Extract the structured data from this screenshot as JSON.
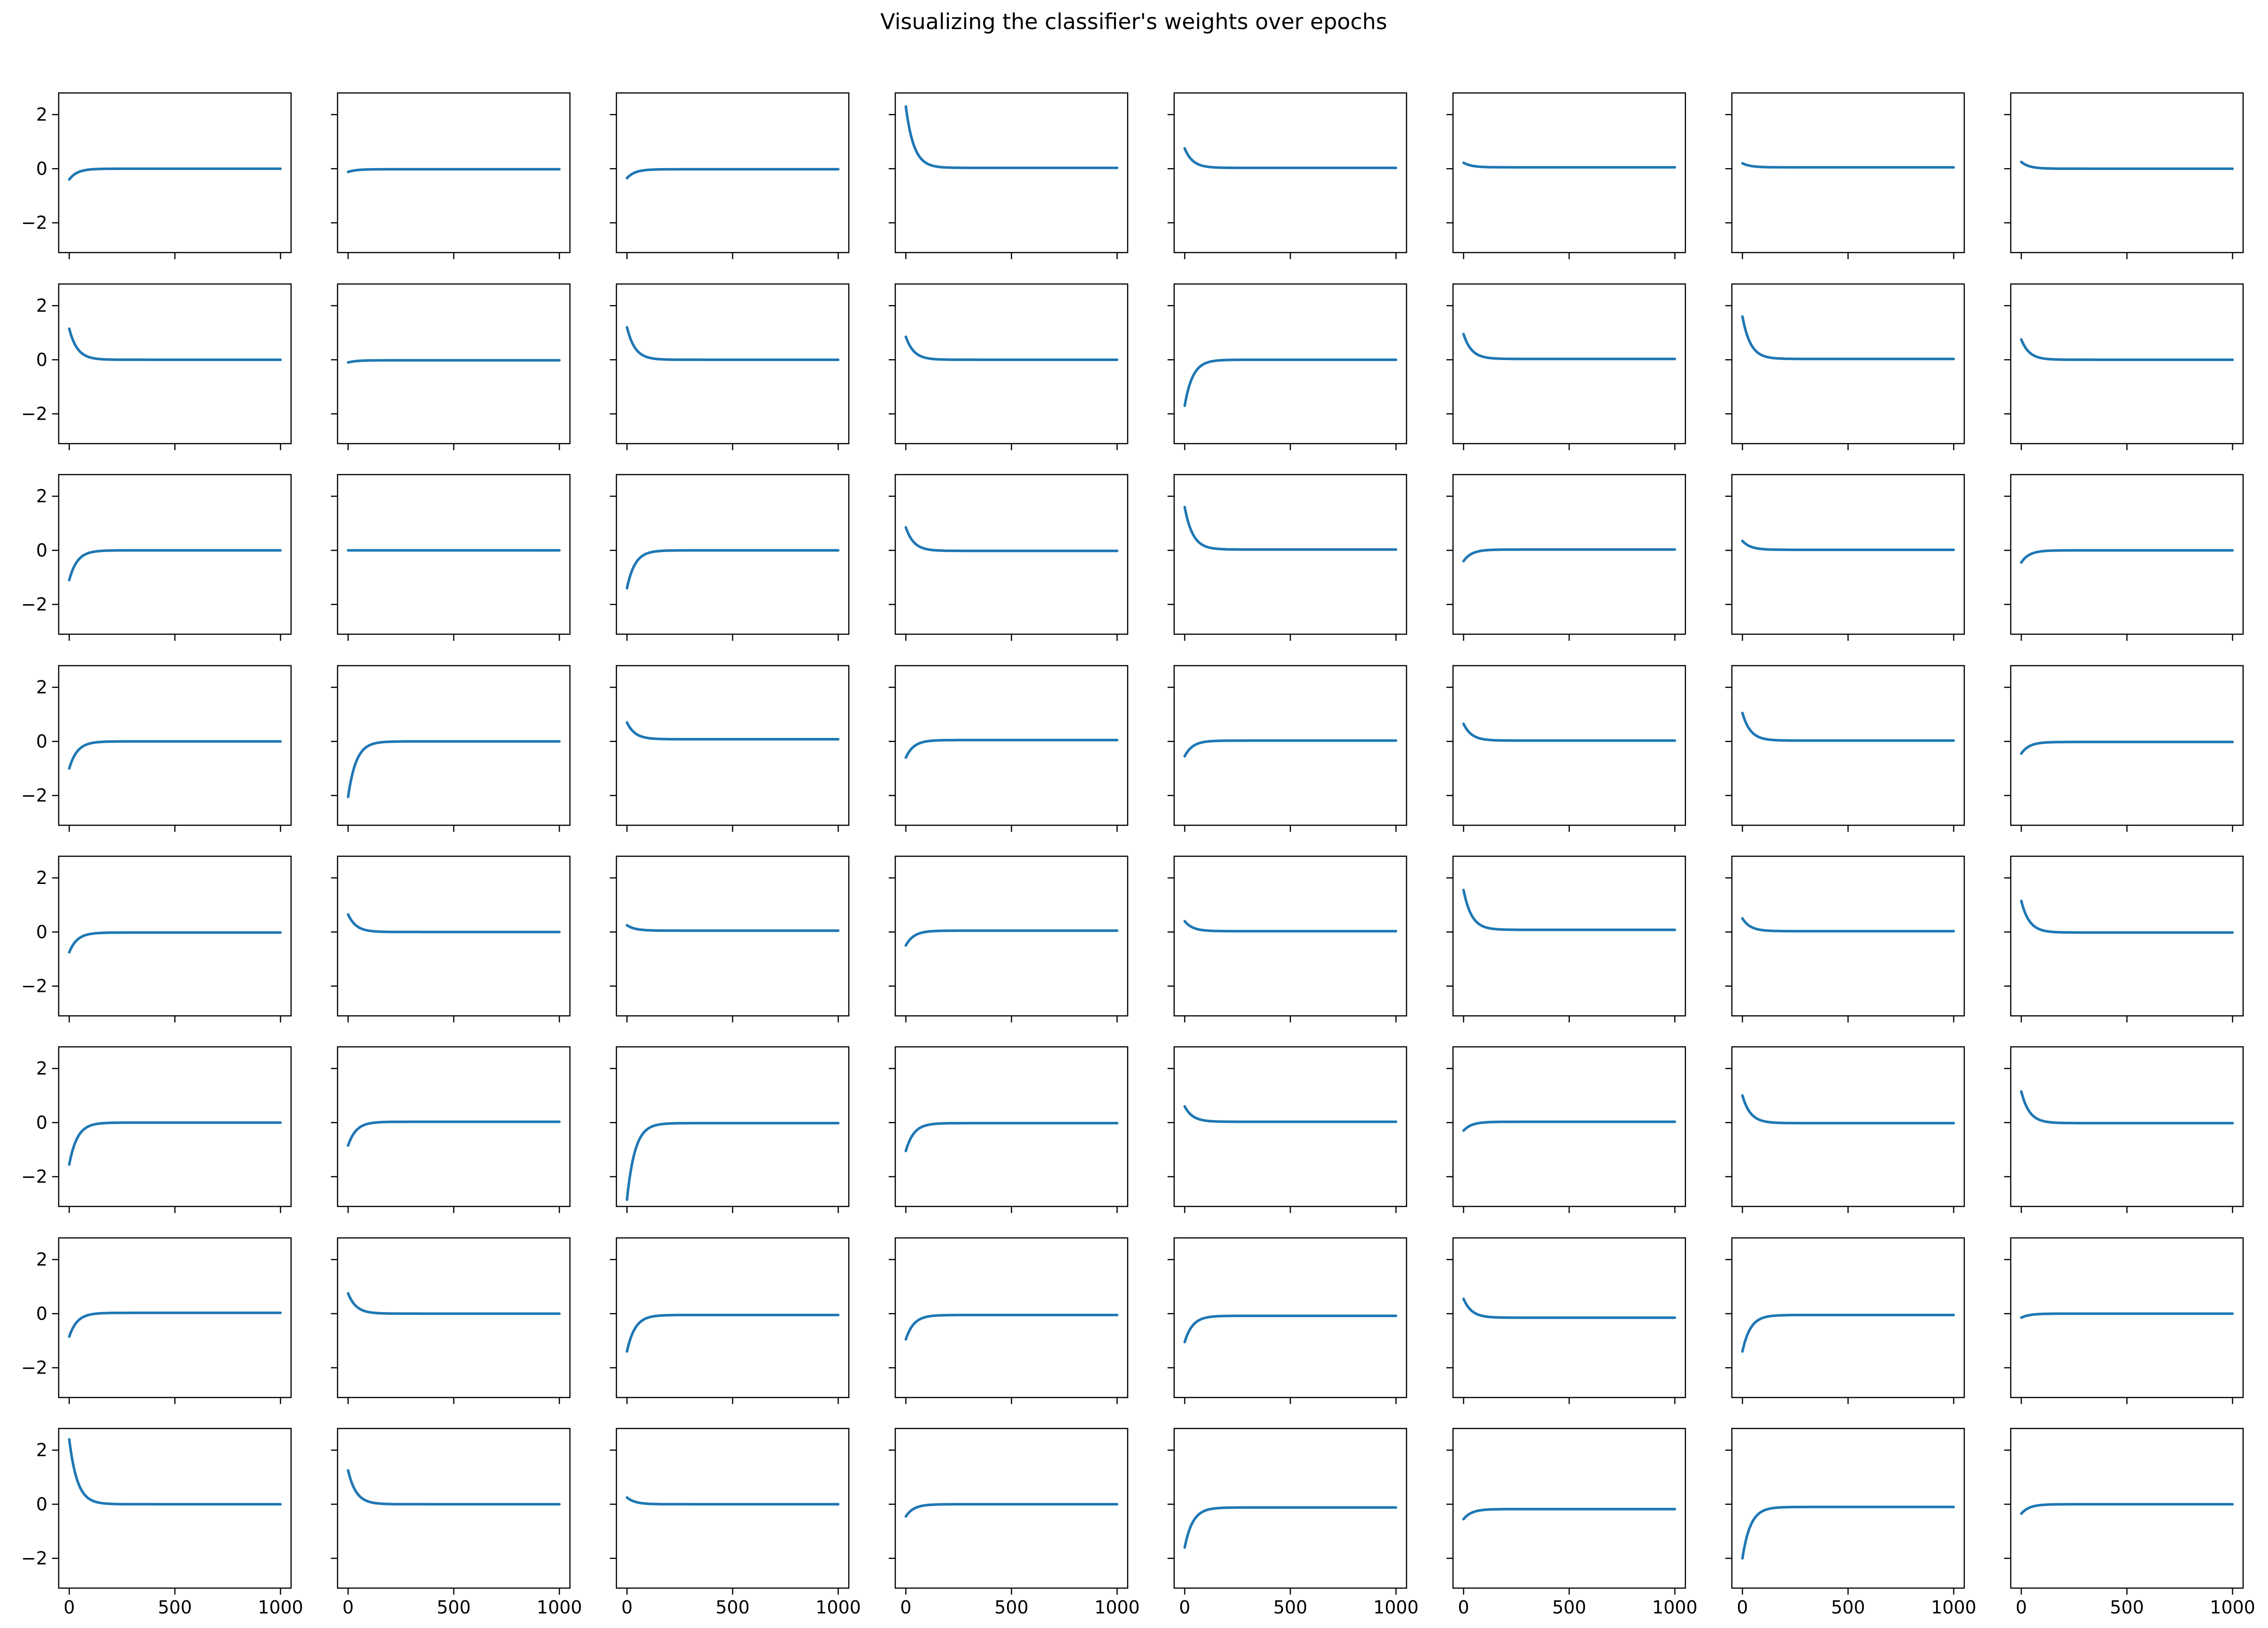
{
  "figure": {
    "title": "Visualizing the classifier's weights over epochs"
  },
  "chart_data": {
    "type": "line",
    "title": "Visualizing the classifier's weights over epochs",
    "xlabel": "",
    "ylabel": "",
    "grid": false,
    "layout_rows": 8,
    "layout_cols": 8,
    "sharex": true,
    "sharey": true,
    "xlim": [
      -50,
      1050
    ],
    "ylim": [
      -3.1,
      2.8
    ],
    "x_ticks": [
      0,
      500,
      1000
    ],
    "y_ticks": [
      2,
      0,
      -2
    ],
    "x_tick_labels": [
      "0",
      "500",
      "1000"
    ],
    "y_tick_labels": [
      "2",
      "0",
      "−2"
    ],
    "line_color": "#1f77b4",
    "epochs": 1000,
    "subplot_note": "Each subplot shows one weight (row-major order, 64 total); each curve starts at start_value and converges toward final_value.",
    "subplots": [
      {
        "row": 0,
        "col": 0,
        "start_value": -0.4,
        "final_value": 0.0
      },
      {
        "row": 0,
        "col": 1,
        "start_value": -0.12,
        "final_value": -0.02
      },
      {
        "row": 0,
        "col": 2,
        "start_value": -0.35,
        "final_value": -0.02
      },
      {
        "row": 0,
        "col": 3,
        "start_value": 2.3,
        "final_value": 0.03
      },
      {
        "row": 0,
        "col": 4,
        "start_value": 0.75,
        "final_value": 0.03
      },
      {
        "row": 0,
        "col": 5,
        "start_value": 0.22,
        "final_value": 0.05
      },
      {
        "row": 0,
        "col": 6,
        "start_value": 0.2,
        "final_value": 0.05
      },
      {
        "row": 0,
        "col": 7,
        "start_value": 0.25,
        "final_value": 0.0
      },
      {
        "row": 1,
        "col": 0,
        "start_value": 1.15,
        "final_value": 0.0
      },
      {
        "row": 1,
        "col": 1,
        "start_value": -0.1,
        "final_value": -0.02
      },
      {
        "row": 1,
        "col": 2,
        "start_value": 1.2,
        "final_value": 0.0
      },
      {
        "row": 1,
        "col": 3,
        "start_value": 0.85,
        "final_value": 0.0
      },
      {
        "row": 1,
        "col": 4,
        "start_value": -1.7,
        "final_value": 0.0
      },
      {
        "row": 1,
        "col": 5,
        "start_value": 0.95,
        "final_value": 0.03
      },
      {
        "row": 1,
        "col": 6,
        "start_value": 1.6,
        "final_value": 0.03
      },
      {
        "row": 1,
        "col": 7,
        "start_value": 0.75,
        "final_value": 0.0
      },
      {
        "row": 2,
        "col": 0,
        "start_value": -1.1,
        "final_value": 0.0
      },
      {
        "row": 2,
        "col": 1,
        "start_value": 0.0,
        "final_value": 0.0
      },
      {
        "row": 2,
        "col": 2,
        "start_value": -1.4,
        "final_value": 0.0
      },
      {
        "row": 2,
        "col": 3,
        "start_value": 0.85,
        "final_value": -0.02
      },
      {
        "row": 2,
        "col": 4,
        "start_value": 1.6,
        "final_value": 0.03
      },
      {
        "row": 2,
        "col": 5,
        "start_value": -0.4,
        "final_value": 0.03
      },
      {
        "row": 2,
        "col": 6,
        "start_value": 0.35,
        "final_value": 0.02
      },
      {
        "row": 2,
        "col": 7,
        "start_value": -0.45,
        "final_value": 0.0
      },
      {
        "row": 3,
        "col": 0,
        "start_value": -1.0,
        "final_value": 0.0
      },
      {
        "row": 3,
        "col": 1,
        "start_value": -2.05,
        "final_value": 0.0
      },
      {
        "row": 3,
        "col": 2,
        "start_value": 0.7,
        "final_value": 0.08
      },
      {
        "row": 3,
        "col": 3,
        "start_value": -0.6,
        "final_value": 0.05
      },
      {
        "row": 3,
        "col": 4,
        "start_value": -0.55,
        "final_value": 0.03
      },
      {
        "row": 3,
        "col": 5,
        "start_value": 0.65,
        "final_value": 0.03
      },
      {
        "row": 3,
        "col": 6,
        "start_value": 1.05,
        "final_value": 0.03
      },
      {
        "row": 3,
        "col": 7,
        "start_value": -0.45,
        "final_value": -0.02
      },
      {
        "row": 4,
        "col": 0,
        "start_value": -0.75,
        "final_value": -0.02
      },
      {
        "row": 4,
        "col": 1,
        "start_value": 0.65,
        "final_value": 0.0
      },
      {
        "row": 4,
        "col": 2,
        "start_value": 0.25,
        "final_value": 0.05
      },
      {
        "row": 4,
        "col": 3,
        "start_value": -0.5,
        "final_value": 0.05
      },
      {
        "row": 4,
        "col": 4,
        "start_value": 0.4,
        "final_value": 0.03
      },
      {
        "row": 4,
        "col": 5,
        "start_value": 1.55,
        "final_value": 0.08
      },
      {
        "row": 4,
        "col": 6,
        "start_value": 0.5,
        "final_value": 0.03
      },
      {
        "row": 4,
        "col": 7,
        "start_value": 1.15,
        "final_value": -0.02
      },
      {
        "row": 5,
        "col": 0,
        "start_value": -1.55,
        "final_value": 0.0
      },
      {
        "row": 5,
        "col": 1,
        "start_value": -0.85,
        "final_value": 0.03
      },
      {
        "row": 5,
        "col": 2,
        "start_value": -2.85,
        "final_value": -0.02
      },
      {
        "row": 5,
        "col": 3,
        "start_value": -1.05,
        "final_value": -0.02
      },
      {
        "row": 5,
        "col": 4,
        "start_value": 0.6,
        "final_value": 0.03
      },
      {
        "row": 5,
        "col": 5,
        "start_value": -0.3,
        "final_value": 0.03
      },
      {
        "row": 5,
        "col": 6,
        "start_value": 1.0,
        "final_value": -0.02
      },
      {
        "row": 5,
        "col": 7,
        "start_value": 1.15,
        "final_value": -0.02
      },
      {
        "row": 6,
        "col": 0,
        "start_value": -0.85,
        "final_value": 0.03
      },
      {
        "row": 6,
        "col": 1,
        "start_value": 0.75,
        "final_value": 0.0
      },
      {
        "row": 6,
        "col": 2,
        "start_value": -1.4,
        "final_value": -0.05
      },
      {
        "row": 6,
        "col": 3,
        "start_value": -0.95,
        "final_value": -0.05
      },
      {
        "row": 6,
        "col": 4,
        "start_value": -1.05,
        "final_value": -0.08
      },
      {
        "row": 6,
        "col": 5,
        "start_value": 0.55,
        "final_value": -0.15
      },
      {
        "row": 6,
        "col": 6,
        "start_value": -1.4,
        "final_value": -0.05
      },
      {
        "row": 6,
        "col": 7,
        "start_value": -0.15,
        "final_value": 0.0
      },
      {
        "row": 7,
        "col": 0,
        "start_value": 2.4,
        "final_value": 0.0
      },
      {
        "row": 7,
        "col": 1,
        "start_value": 1.25,
        "final_value": 0.0
      },
      {
        "row": 7,
        "col": 2,
        "start_value": 0.25,
        "final_value": 0.0
      },
      {
        "row": 7,
        "col": 3,
        "start_value": -0.45,
        "final_value": 0.0
      },
      {
        "row": 7,
        "col": 4,
        "start_value": -1.6,
        "final_value": -0.12
      },
      {
        "row": 7,
        "col": 5,
        "start_value": -0.55,
        "final_value": -0.18
      },
      {
        "row": 7,
        "col": 6,
        "start_value": -2.0,
        "final_value": -0.1
      },
      {
        "row": 7,
        "col": 7,
        "start_value": -0.35,
        "final_value": 0.0
      }
    ]
  }
}
